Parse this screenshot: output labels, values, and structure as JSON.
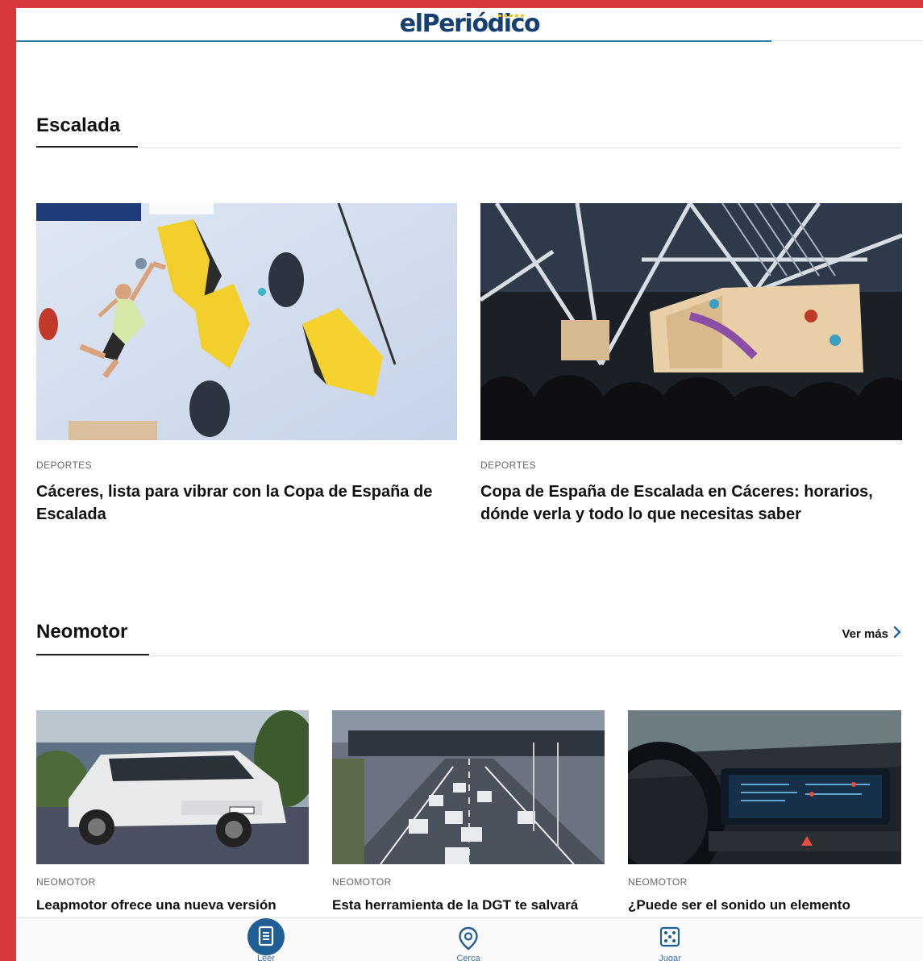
{
  "header": {
    "logo_text": "elPeriódico"
  },
  "sections": [
    {
      "title": "Escalada",
      "articles": [
        {
          "kicker": "DEPORTES",
          "headline": "Cáceres, lista para vibrar con la Copa de España de Escalada",
          "image": "climber-on-yellow-holds-photo"
        },
        {
          "kicker": "DEPORTES",
          "headline": "Copa de España de Escalada en Cáceres: horarios, dónde verla y todo lo que necesitas saber",
          "image": "climbing-arena-crowd-photo"
        }
      ]
    },
    {
      "title": "Neomotor",
      "see_more": "Ver más",
      "articles": [
        {
          "kicker": "NEOMOTOR",
          "headline": "Leapmotor ofrece una nueva versión",
          "image": "white-suv-photo"
        },
        {
          "kicker": "NEOMOTOR",
          "headline": "Esta herramienta de la DGT te salvará",
          "image": "highway-traffic-photo"
        },
        {
          "kicker": "NEOMOTOR",
          "headline": "¿Puede ser el sonido un elemento",
          "image": "car-dashboard-photo"
        }
      ]
    }
  ],
  "bottom_nav": [
    {
      "label": "Leer",
      "icon": "document-icon",
      "active": true
    },
    {
      "label": "Cerca",
      "icon": "location-pin-icon",
      "active": false
    },
    {
      "label": "Jugar",
      "icon": "dice-icon",
      "active": false
    }
  ],
  "colors": {
    "brand_blue": "#163f72",
    "accent_blue": "#2c7ea8",
    "nav_active": "#1f5f96",
    "frame_red": "#d63a3a",
    "logo_dots": "#f1c40f"
  }
}
